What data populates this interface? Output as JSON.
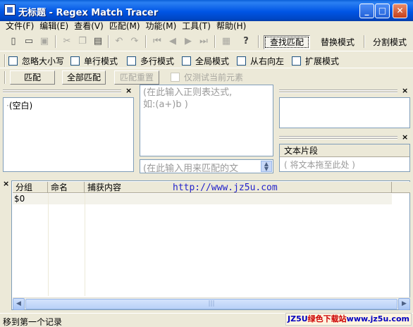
{
  "window": {
    "title": "无标题 - Regex Match Tracer",
    "minimize": "_",
    "maximize": "□",
    "close": "✕"
  },
  "menu": [
    "文件(F)",
    "编辑(E)",
    "查看(V)",
    "匹配(M)",
    "功能(M)",
    "工具(T)",
    "帮助(H)"
  ],
  "toolbar": {
    "icons": [
      "new-file-icon",
      "open-folder-icon",
      "save-icon",
      "cut-icon",
      "copy-icon",
      "paste-icon",
      "undo-icon",
      "redo-icon",
      "first-icon",
      "prev-icon",
      "next-icon",
      "last-icon",
      "bookmark-icon",
      "help-icon"
    ],
    "modes": [
      "查找匹配",
      "替换模式",
      "分割模式"
    ],
    "active_mode": "查找匹配"
  },
  "options": [
    "忽略大小写",
    "单行模式",
    "多行模式",
    "全局模式",
    "从右向左",
    "扩展模式"
  ],
  "actions": {
    "match": "匹配",
    "match_all": "全部匹配",
    "match_reset": "匹配重置",
    "test_current_only": "仅测试当前元素"
  },
  "tree": {
    "root": "(空白)"
  },
  "regex_input": {
    "placeholder": "(在此输入正则表达式,\n如:(a+)b )"
  },
  "match_input": {
    "placeholder": "(在此输入用来匹配的文"
  },
  "snippets": {
    "header": "文本片段",
    "hint": "( 将文本拖至此处 )"
  },
  "results": {
    "columns": [
      "分组",
      "命名",
      "捕获内容"
    ],
    "rows": [
      {
        "group": "$0",
        "name": "",
        "content": ""
      }
    ],
    "watermark_url": "http://www.jz5u.com"
  },
  "status": {
    "text": "移到第一个记录",
    "watermark_brand": "JZ5U",
    "watermark_name": "绿色下载站",
    "watermark_url": "www.jz5u.com"
  }
}
